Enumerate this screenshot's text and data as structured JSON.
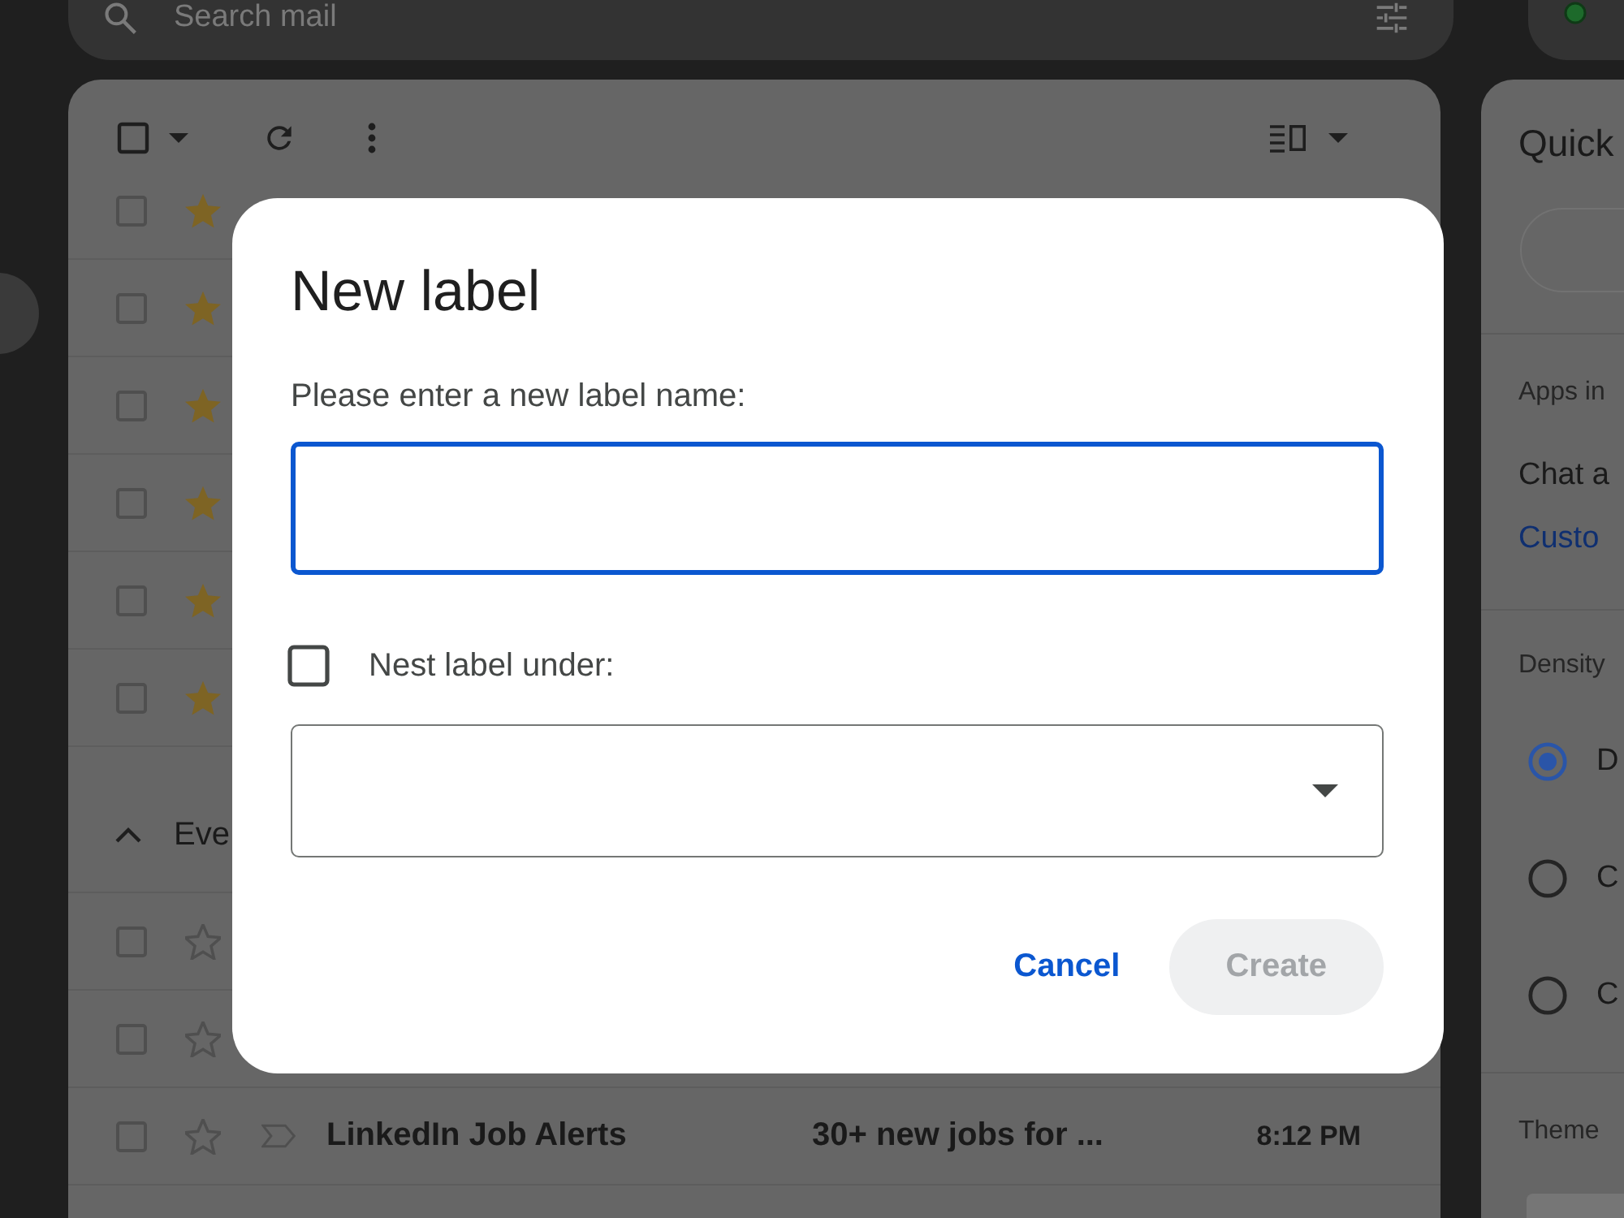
{
  "search_bar": {
    "placeholder": "Search mail"
  },
  "sidebar": {
    "items": [
      {
        "selected": true
      }
    ]
  },
  "mail_list": {
    "toolbar": {
      "select_all": {
        "checked": false
      }
    },
    "rows": [
      {
        "checked": false,
        "starred": true
      },
      {
        "checked": false,
        "starred": true
      },
      {
        "checked": false,
        "starred": true
      },
      {
        "checked": false,
        "starred": true
      },
      {
        "checked": false,
        "starred": true
      },
      {
        "checked": false,
        "starred": true
      }
    ],
    "sections": [
      {
        "title": "Eve",
        "expanded": true,
        "rows": [
          {
            "checked": false,
            "starred": false
          },
          {
            "checked": false,
            "starred": false
          },
          {
            "checked": false,
            "starred": false,
            "important": false,
            "unread": true,
            "sender": "LinkedIn Job Alerts",
            "subject": "30+ new jobs for ...",
            "time": "8:12 PM"
          }
        ]
      }
    ]
  },
  "quick_settings": {
    "title": "Quick",
    "apps_heading": "Apps in",
    "chat_setting": "Chat a",
    "customize_link": "Custo",
    "density_heading": "Density",
    "density_options": [
      {
        "label": "D",
        "selected": true
      },
      {
        "label": "C",
        "selected": false
      },
      {
        "label": "C",
        "selected": false
      }
    ],
    "theme_heading": "Theme"
  },
  "dialog": {
    "title": "New label",
    "name_prompt": "Please enter a new label name:",
    "name_field": {
      "focused": true
    },
    "nest_option": {
      "label": "Nest label under:",
      "checked": false
    },
    "buttons": [
      {
        "label": "Cancel",
        "kind": "text",
        "disabled": false
      },
      {
        "label": "Create",
        "kind": "filled",
        "disabled": true
      }
    ]
  }
}
